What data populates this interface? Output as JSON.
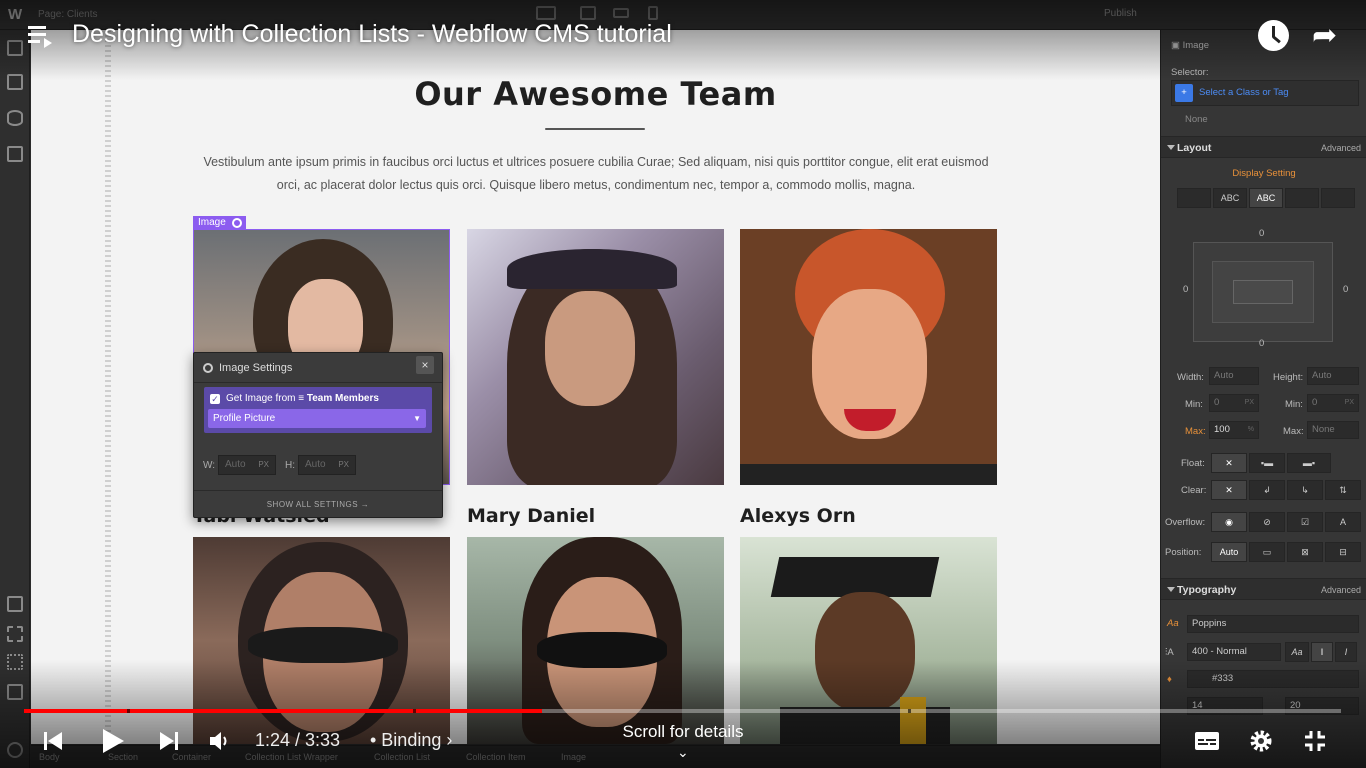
{
  "video": {
    "title": "Designing with Collection Lists - Webflow CMS tutorial",
    "current_time": "1:24",
    "duration": "3:33",
    "time_display": "1:24 / 3:33",
    "chapter": "• Binding",
    "chapter_arrow": "›",
    "scroll_hint": "Scroll for details",
    "progress_fraction": 0.393,
    "share_glyph": "➦"
  },
  "designer": {
    "logo": "W",
    "page_label": "Page: Clients",
    "publish": "Publish"
  },
  "canvas": {
    "heading": "Our Awesome Team",
    "intro": "Vestibulum ante ipsum primis in faucibus orci luctus et ultrices posuere cubilia Curae; Sed aliquam, nisi quis porttitor congue, elit erat euismod orci, ac placerat dolor lectus quis orci. Quisque libero metus, condimentum nec, tempor a, commodo mollis, magna.",
    "selected_tag": "Image",
    "team": [
      {
        "name": "Tabi Watsled"
      },
      {
        "name": "Mary Daniel"
      },
      {
        "name": "Alexys Orn"
      }
    ]
  },
  "image_settings": {
    "title": "Image Settings",
    "close": "×",
    "bind_prefix": "Get Image from",
    "bind_collection": "Team Members",
    "field": "Profile Picture",
    "w_label": "W:",
    "h_label": "H:",
    "w_placeholder": "Auto",
    "h_placeholder": "Auto",
    "unit": "PX",
    "show_all": "SHOW ALL SETTINGS →"
  },
  "style_panel": {
    "element": "Image",
    "selector_label": "Selector:",
    "selector_placeholder": "Select a Class or Tag",
    "selector_none": "None",
    "layout": {
      "title": "Layout",
      "advanced": "Advanced",
      "display_setting": "Display Setting",
      "display_options": [
        "",
        "ABC",
        "ABC",
        "",
        ""
      ]
    },
    "box_values": {
      "zero": "0"
    },
    "size": {
      "width_label": "Width:",
      "width": "Auto",
      "height_label": "Height:",
      "height": "Auto",
      "min_label": "Min:",
      "min": "0",
      "min_h": "0",
      "max_label": "Max:",
      "max": "100",
      "max_unit": "%",
      "max_h": "None",
      "px": "PX"
    },
    "float_label": "Float:",
    "clear_label": "Clear:",
    "overflow_label": "Overflow:",
    "position_label": "Position:",
    "position_value": "Auto",
    "typography": {
      "title": "Typography",
      "advanced": "Advanced",
      "font": "Poppins",
      "weight": "400 - Normal",
      "color": "#333",
      "size": "14",
      "line_height": "20"
    }
  },
  "breadcrumbs": [
    "Body",
    "Section",
    "Container",
    "Collection List Wrapper",
    "Collection List",
    "Collection Item",
    "Image"
  ],
  "colors": {
    "youtube_red": "#ff0000",
    "webflow_purple": "#8c5cf0",
    "binding_purple": "#5b4aa8",
    "accent_orange": "#e8913a"
  }
}
